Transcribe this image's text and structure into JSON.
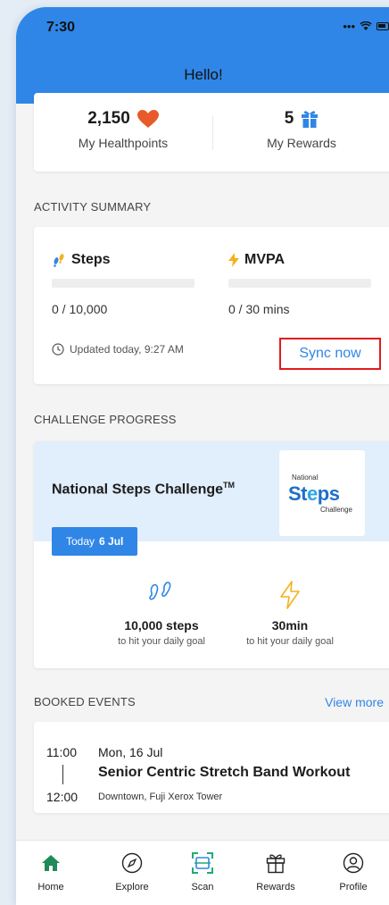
{
  "status_bar": {
    "time": "7:30",
    "signal": "•••"
  },
  "header": {
    "title": "Hello!"
  },
  "summary": {
    "healthpoints_value": "2,150",
    "healthpoints_label": "My Healthpoints",
    "rewards_value": "5",
    "rewards_label": "My Rewards"
  },
  "activity": {
    "section_label": "ACTIVITY SUMMARY",
    "steps_title": "Steps",
    "steps_value": "0 / 10,000",
    "steps_progress": 0,
    "mvpa_title": "MVPA",
    "mvpa_value": "0 / 30 mins",
    "mvpa_progress": 0,
    "updated_text": "Updated today, 9:27 AM",
    "sync_label": "Sync now"
  },
  "challenge": {
    "section_label": "CHALLENGE PROGRESS",
    "title": "National Steps Challenge",
    "title_mark": "TM",
    "logo_top": "National",
    "logo_main_a": "St",
    "logo_main_b": "e",
    "logo_main_c": "ps",
    "logo_bottom": "Challenge",
    "date_prefix": "Today",
    "date_value": "6 Jul",
    "goal_steps": "10,000 steps",
    "goal_steps_sub": "to hit your daily goal",
    "goal_time": "30min",
    "goal_time_sub": "to hit your daily goal"
  },
  "booked": {
    "section_label": "BOOKED EVENTS",
    "view_more": "View more",
    "event": {
      "start": "11:00",
      "end": "12:00",
      "date": "Mon, 16 Jul",
      "title": "Senior Centric Stretch Band Workout",
      "location": "Downtown, Fuji Xerox Tower"
    }
  },
  "tabs": [
    {
      "label": "Home",
      "icon": "home-icon"
    },
    {
      "label": "Explore",
      "icon": "compass-icon"
    },
    {
      "label": "Scan",
      "icon": "scan-icon"
    },
    {
      "label": "Rewards",
      "icon": "gift-icon"
    },
    {
      "label": "Profile",
      "icon": "profile-icon"
    }
  ],
  "colors": {
    "primary": "#2f86e6",
    "heart": "#e85a2a",
    "highlight_border": "#e01b1b",
    "home_active": "#1f8a5a",
    "scan_accent": "#1faa7a",
    "bolt": "#f3b21c"
  }
}
